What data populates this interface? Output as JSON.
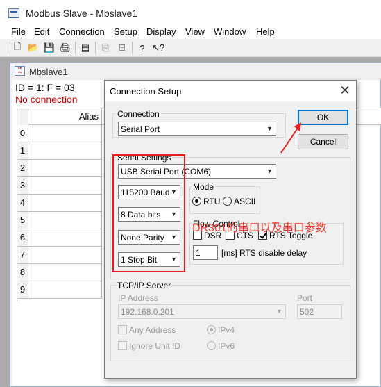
{
  "app": {
    "title": "Modbus Slave - Mbslave1"
  },
  "menu": [
    "File",
    "Edit",
    "Connection",
    "Setup",
    "Display",
    "View",
    "Window",
    "Help"
  ],
  "toolbar": [
    {
      "icon": "new-document-icon",
      "glyph": "🗋"
    },
    {
      "icon": "open-folder-icon",
      "glyph": "📂"
    },
    {
      "icon": "save-icon",
      "glyph": "💾"
    },
    {
      "icon": "print-icon",
      "glyph": "🖨"
    },
    {
      "icon": "window-icon",
      "glyph": "▤"
    },
    {
      "icon": "connect-icon",
      "glyph": "⎘"
    },
    {
      "icon": "disconnect-icon",
      "glyph": "⌸"
    },
    {
      "icon": "help-icon",
      "glyph": "?"
    },
    {
      "icon": "context-help-icon",
      "glyph": "↖?"
    }
  ],
  "child": {
    "title": "Mbslave1",
    "id_line": "ID = 1: F = 03",
    "status": "No connection",
    "alias_header": "Alias",
    "rows": [
      "0",
      "1",
      "2",
      "3",
      "4",
      "5",
      "6",
      "7",
      "8",
      "9"
    ]
  },
  "dialog": {
    "title": "Connection Setup",
    "close_glyph": "✕",
    "connection_group": "Connection",
    "connection_value": "Serial Port",
    "ok_label": "OK",
    "cancel_label": "Cancel",
    "serial_group": "Serial Settings",
    "port_value": "USB Serial Port (COM6)",
    "baud_value": "115200 Baud",
    "databits_value": "8 Data bits",
    "parity_value": "None Parity",
    "stopbit_value": "1 Stop Bit",
    "mode_group": "Mode",
    "mode_rtu": "RTU",
    "mode_ascii": "ASCII",
    "flow_group": "Flow Control",
    "dsr_label": "DSR",
    "cts_label": "CTS",
    "rts_toggle_label": "RTS Toggle",
    "rts_delay_value": "1",
    "rts_delay_label": "[ms] RTS disable delay",
    "tcp_group": "TCP/IP Server",
    "ip_label": "IP Address",
    "ip_value": "192.168.0.201",
    "port_label": "Port",
    "port_number": "502",
    "any_address_label": "Any Address",
    "ignore_unit_label": "Ignore Unit ID",
    "ipv4_label": "IPv4",
    "ipv6_label": "IPv6"
  },
  "annotation": {
    "text": "DR301的串口以及串口参数",
    "color": "#f03a2e"
  }
}
